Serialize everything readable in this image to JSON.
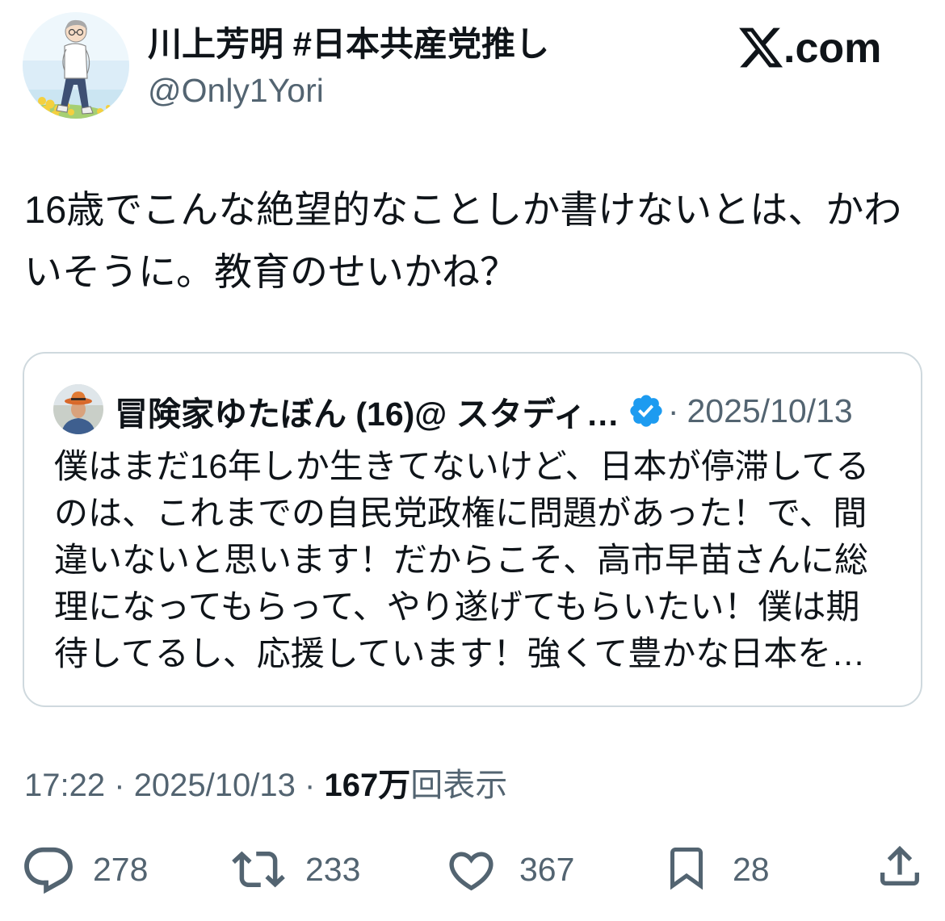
{
  "brand": {
    "logo_icon": "x-logo-icon",
    "logo_letter": "X",
    "suffix": ".com"
  },
  "author": {
    "avatar_icon": "profile-avatar",
    "display_name": "川上芳明 #日本共産党推し",
    "handle": "@Only1Yori"
  },
  "tweet": {
    "text_lines": [
      "16歳でこんな絶望的なことしか書けないとは、かわ",
      "いそうに。教育のせいかね？"
    ]
  },
  "quote": {
    "avatar_icon": "quoted-author-avatar",
    "display_name": "冒険家ゆたぼん (16)@ スタディ…",
    "verified_icon": "verified-badge-icon",
    "separator": "·",
    "date": "2025/10/13",
    "text_lines": [
      "僕はまだ16年しか生きてないけど、日本が停滞してる",
      "のは、これまでの自民党政権に問題があった！で、間",
      "違いないと思います！だからこそ、高市早苗さんに総",
      "理になってもらって、やり遂げてもらいたい！僕は期",
      "待してるし、応援しています！強くて豊かな日本を…"
    ]
  },
  "meta": {
    "time": "17:22",
    "separator": "·",
    "date": "2025/10/13",
    "views_count": "167万",
    "views_label": "回表示"
  },
  "actions": {
    "reply": {
      "icon": "reply-icon",
      "count": "278"
    },
    "retweet": {
      "icon": "retweet-icon",
      "count": "233"
    },
    "like": {
      "icon": "like-icon",
      "count": "367"
    },
    "bookmark": {
      "icon": "bookmark-icon",
      "count": "28"
    },
    "share": {
      "icon": "share-icon"
    }
  },
  "colors": {
    "text": "#0f1419",
    "secondary": "#536471",
    "border": "#cfd9de",
    "verified": "#1d9bf0"
  }
}
